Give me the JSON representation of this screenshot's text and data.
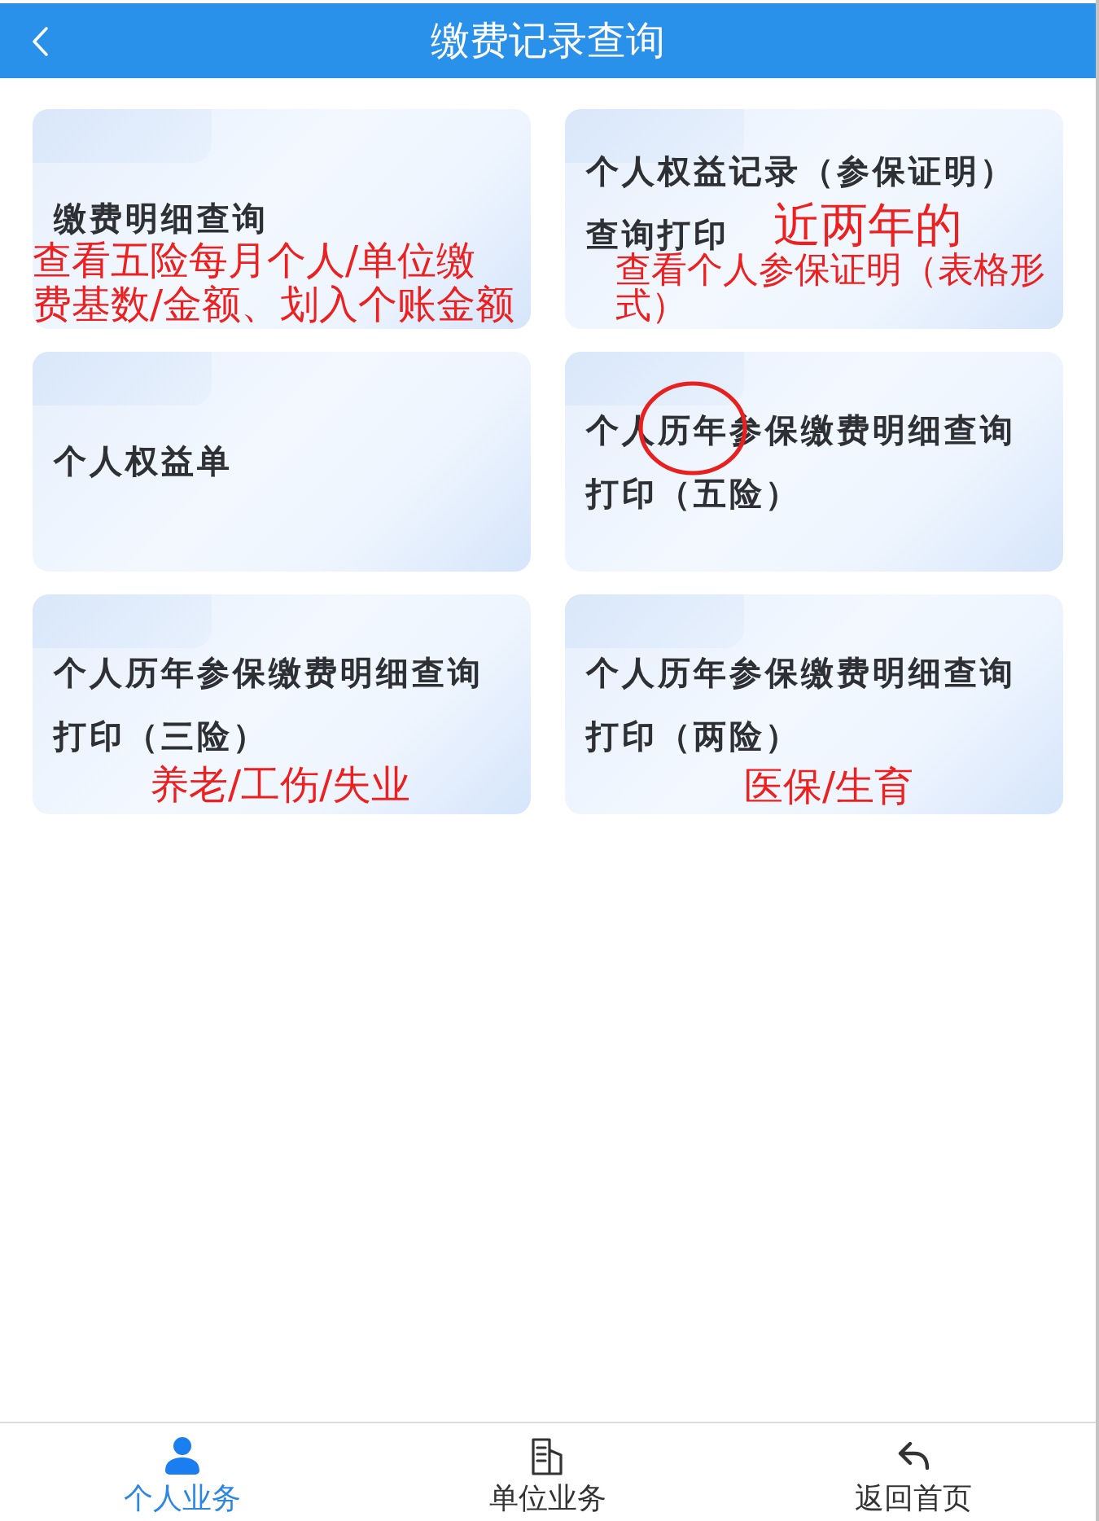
{
  "header": {
    "title": "缴费记录查询"
  },
  "cards": [
    {
      "title": "缴费明细查询"
    },
    {
      "title": "个人权益单"
    },
    {
      "title": "个人历年参保缴费明细查询打印（三险）"
    },
    {
      "title": "个人权益记录（参保证明）查询打印"
    },
    {
      "title": "个人历年参保缴费明细查询打印（五险）"
    },
    {
      "title": "个人历年参保缴费明细查询打印（两险）"
    }
  ],
  "annotations": [
    {
      "kind": "text",
      "lines": [
        "查看五险每月个人/单位缴",
        "费基数/金额、划入个账金额"
      ]
    },
    {
      "kind": "text",
      "lines": [
        "养老/工伤/失业"
      ]
    },
    {
      "kind": "text",
      "lines": [
        "近两年的"
      ]
    },
    {
      "kind": "text",
      "lines": [
        "查看个人参保证明（表格形",
        "式）"
      ]
    },
    {
      "kind": "circle"
    },
    {
      "kind": "text",
      "lines": [
        "医保/生育"
      ]
    }
  ],
  "tab_bar": {
    "items": [
      {
        "label": "个人业务",
        "selected": true
      },
      {
        "label": "单位业务",
        "selected": false
      },
      {
        "label": "返回首页",
        "selected": false
      }
    ]
  }
}
